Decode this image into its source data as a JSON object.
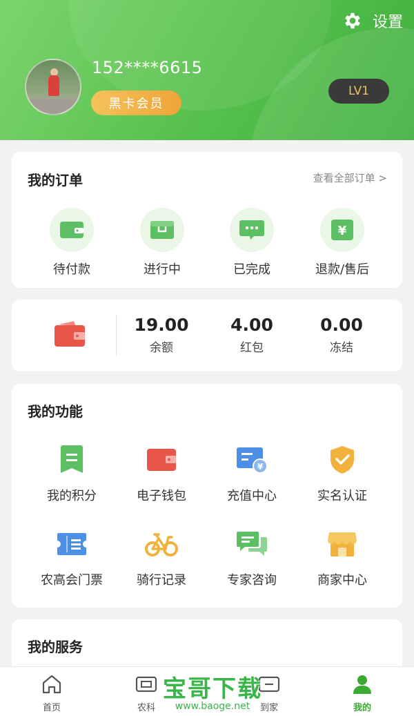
{
  "header": {
    "settings_label": "设置",
    "phone": "152****6615",
    "member_badge": "黑卡会员",
    "level": "LV1"
  },
  "orders": {
    "title": "我的订单",
    "view_all": "查看全部订单 >",
    "items": [
      {
        "label": "待付款",
        "icon": "wallet-icon"
      },
      {
        "label": "进行中",
        "icon": "box-icon"
      },
      {
        "label": "已完成",
        "icon": "chat-bubble-icon"
      },
      {
        "label": "退款/售后",
        "icon": "yen-icon"
      }
    ]
  },
  "wallet": {
    "stats": [
      {
        "value": "19.00",
        "label": "余额"
      },
      {
        "value": "4.00",
        "label": "红包"
      },
      {
        "value": "0.00",
        "label": "冻结"
      }
    ]
  },
  "functions": {
    "title": "我的功能",
    "items": [
      {
        "label": "我的积分",
        "icon": "points-icon"
      },
      {
        "label": "电子钱包",
        "icon": "e-wallet-icon"
      },
      {
        "label": "充值中心",
        "icon": "recharge-icon"
      },
      {
        "label": "实名认证",
        "icon": "verified-shield-icon"
      },
      {
        "label": "农高会门票",
        "icon": "ticket-icon"
      },
      {
        "label": "骑行记录",
        "icon": "bicycle-icon"
      },
      {
        "label": "专家咨询",
        "icon": "consult-icon"
      },
      {
        "label": "商家中心",
        "icon": "store-icon"
      }
    ]
  },
  "services": {
    "title": "我的服务"
  },
  "tabbar": {
    "items": [
      {
        "label": "首页",
        "icon": "home-icon"
      },
      {
        "label": "农科",
        "icon": "ticket-scan-icon"
      },
      {
        "label": "到家",
        "icon": "delivery-icon"
      },
      {
        "label": "我的",
        "icon": "person-icon"
      }
    ],
    "active_index": 3
  },
  "watermark": {
    "main": "宝哥下载",
    "url": "www.baoge.net"
  },
  "colors": {
    "brand_green": "#4cbb47",
    "icon_green": "#5cbf64",
    "wallet_red": "#e8564a",
    "gold": "#f0b23b",
    "blue": "#4e8fe6"
  }
}
